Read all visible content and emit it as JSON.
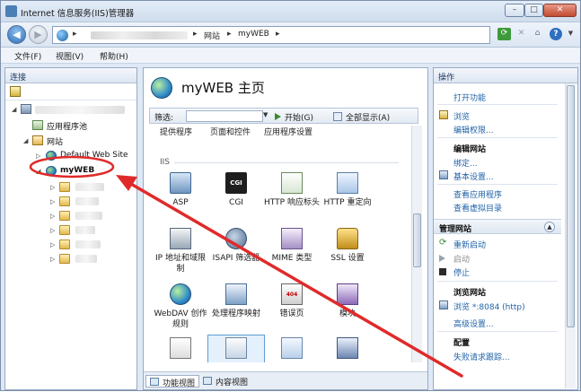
{
  "window": {
    "title": "Internet 信息服务(IIS)管理器"
  },
  "address": {
    "crumbs": [
      "网站",
      "myWEB"
    ]
  },
  "menu": [
    "文件(F)",
    "视图(V)",
    "帮助(H)"
  ],
  "left": {
    "header": "连接",
    "tree": {
      "app_pools": "应用程序池",
      "sites": "网站",
      "default_site": "Default Web Site",
      "myweb": "myWEB"
    }
  },
  "center": {
    "title": "myWEB 主页",
    "filter_label": "筛选:",
    "start_label": "开始(G)",
    "show_all_label": "全部显示(A)",
    "cut_labels": [
      "提供程序",
      "页面和控件",
      "应用程序设置"
    ],
    "section": "IIS",
    "features": [
      {
        "label": "ASP",
        "icon": "asp-icon"
      },
      {
        "label": "CGI",
        "icon": "cgi-icon"
      },
      {
        "label": "HTTP 响应标头",
        "icon": "http-headers-icon"
      },
      {
        "label": "HTTP 重定向",
        "icon": "http-redirect-icon"
      },
      {
        "label": "IP 地址和域限制",
        "icon": "ip-restrictions-icon"
      },
      {
        "label": "ISAPI 筛选器",
        "icon": "isapi-filter-icon"
      },
      {
        "label": "MIME 类型",
        "icon": "mime-type-icon"
      },
      {
        "label": "SSL 设置",
        "icon": "lock-icon"
      },
      {
        "label": "WebDAV 创作规则",
        "icon": "webdav-icon"
      },
      {
        "label": "处理程序映射",
        "icon": "handler-mapping-icon"
      },
      {
        "label": "错误页",
        "icon": "error-page-icon"
      },
      {
        "label": "模块",
        "icon": "module-icon"
      }
    ],
    "cgi_badge": "CGI",
    "error_badge": "404",
    "tabs": {
      "features": "功能视图",
      "content": "内容视图"
    }
  },
  "right": {
    "header": "操作",
    "open_feature": "打开功能",
    "browse": "浏览",
    "edit_perms": "编辑权限...",
    "edit_site": "编辑网站",
    "bindings": "绑定...",
    "basic_settings": "基本设置...",
    "view_apps": "查看应用程序",
    "view_vdirs": "查看虚拟目录",
    "manage_site": "管理网站",
    "restart": "重新启动",
    "start": "启动",
    "stop": "停止",
    "browse_site": "浏览网站",
    "browse_link": "浏览 *:8084 (http)",
    "advanced": "高级设置...",
    "config": "配置",
    "failed_req": "失败请求跟踪..."
  },
  "colors": {
    "annotation": "#e02a2a",
    "link": "#2163a8"
  }
}
